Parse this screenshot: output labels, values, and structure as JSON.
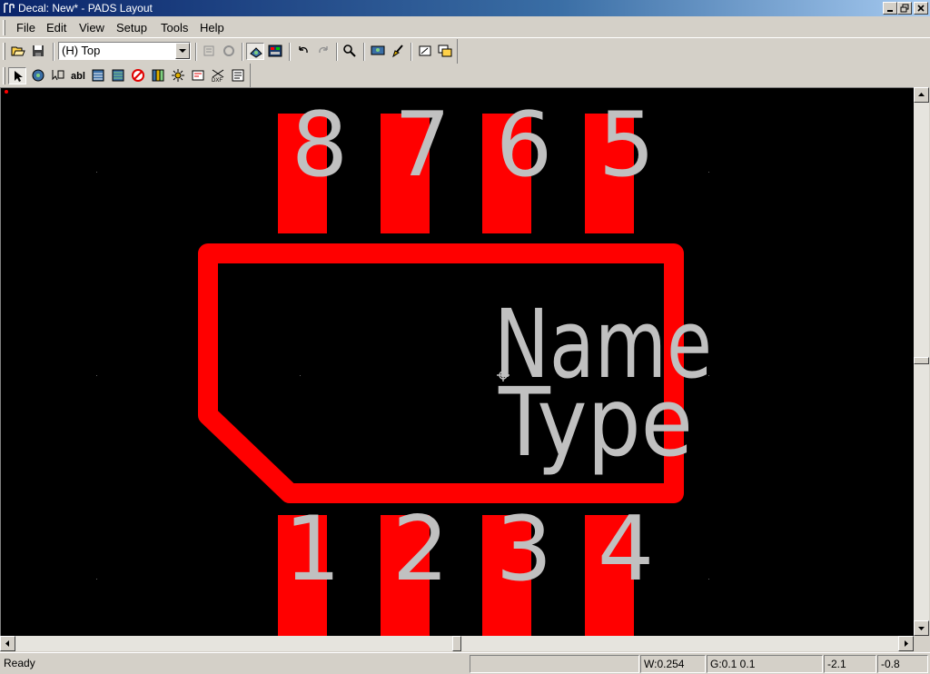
{
  "window": {
    "title": "Decal: New* - PADS Layout"
  },
  "menu": {
    "items": [
      "File",
      "Edit",
      "View",
      "Setup",
      "Tools",
      "Help"
    ]
  },
  "toolbar": {
    "layer_select_value": "(H) Top",
    "standard_icons": [
      "open-icon",
      "save-icon",
      "layer-select",
      "properties-icon",
      "redraw-icon",
      "toggle-fill-icon",
      "display-colors-icon",
      "undo-icon",
      "redo-icon",
      "zoom-icon",
      "view-icon",
      "cleanup-icon",
      "capture-icon",
      "window-icon"
    ],
    "drafting_icons": [
      "select-icon",
      "wizard-icon",
      "terminal-icon",
      "text-icon",
      "copper-icon",
      "copper-cutout-icon",
      "keepout-icon",
      "library-icon",
      "pad-stacks-icon",
      "attribute-icon",
      "dxf-import-icon",
      "properties-list-icon"
    ]
  },
  "canvas": {
    "background": "#000000",
    "pad_color": "#ff0000",
    "outline_color": "#ff0000",
    "text_color": "#c0c0c0",
    "pin_numbers_top": [
      "8",
      "7",
      "6",
      "5"
    ],
    "pin_numbers_bottom": [
      "1",
      "2",
      "3",
      "4"
    ],
    "label_name": "Name",
    "label_type": "Type"
  },
  "status": {
    "message": "Ready",
    "width": "W:0.254",
    "grid": "G:0.1 0.1",
    "x": "-2.1",
    "y": "-0.8"
  }
}
